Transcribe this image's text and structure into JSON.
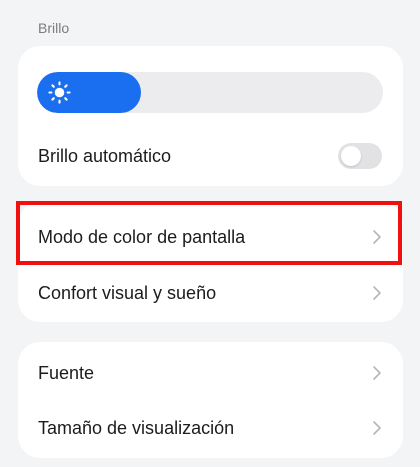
{
  "section": {
    "title": "Brillo"
  },
  "brightness": {
    "level_percent": 30,
    "icon": "sun-icon",
    "auto_label": "Brillo automático",
    "auto_enabled": false
  },
  "display": {
    "items": [
      {
        "label": "Modo de color de pantalla",
        "icon": "chevron-right-icon"
      },
      {
        "label": "Confort visual y sueño",
        "icon": "chevron-right-icon"
      }
    ]
  },
  "font": {
    "items": [
      {
        "label": "Fuente",
        "icon": "chevron-right-icon"
      },
      {
        "label": "Tamaño de visualización",
        "icon": "chevron-right-icon"
      }
    ]
  },
  "colors": {
    "accent": "#1a6ff0",
    "highlight": "#f01010",
    "background": "#f3f4f6",
    "card": "#ffffff"
  }
}
